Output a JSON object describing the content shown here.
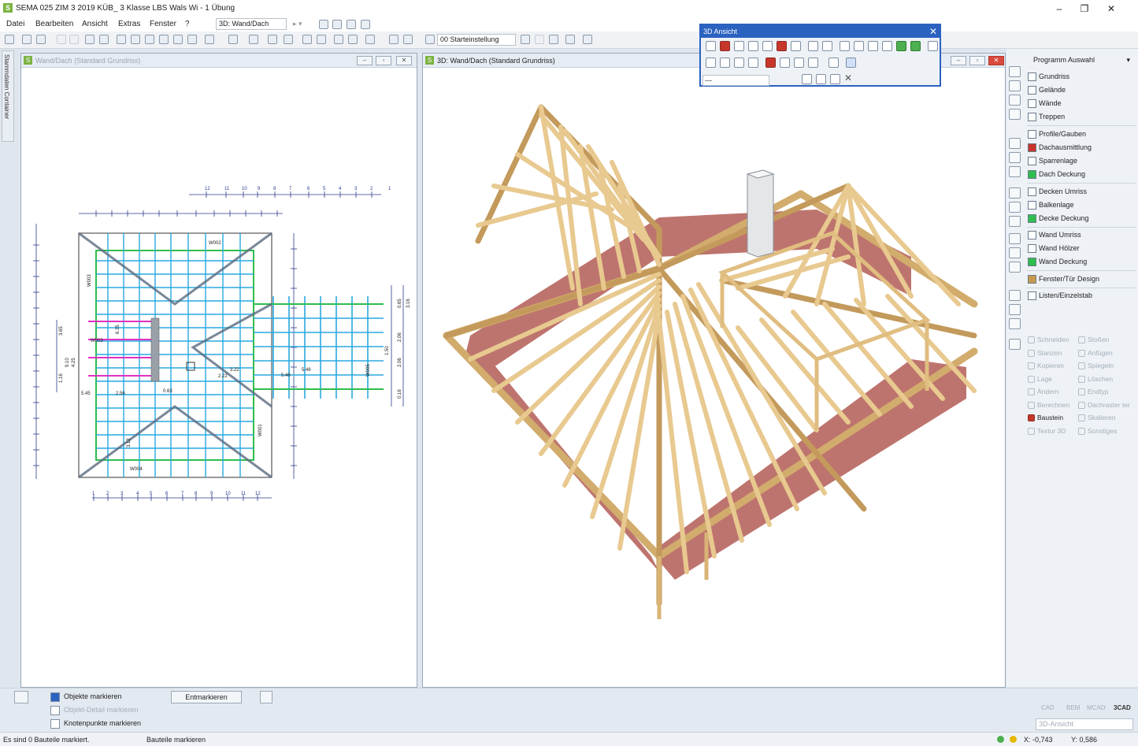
{
  "window": {
    "title": "SEMA 025 ZIM 3 2019 KÜB_ 3 Klasse LBS Wals Wi - 1 Übung",
    "app_logo": "S"
  },
  "menu": [
    "Datei",
    "Bearbeiten",
    "Ansicht",
    "Extras",
    "Fenster",
    "?"
  ],
  "toolbar": {
    "view_combo": "3D: Wand/Dach",
    "start_combo": "00 Starteinstellung"
  },
  "sidebar_tab": "Stammdaten Container",
  "left_pane": {
    "title": "Wand/Dach (Standard Grundriss)",
    "wall_labels": [
      "W002",
      "W003",
      "W001",
      "W004",
      "W005",
      "W005",
      "W006"
    ],
    "dims": [
      "5.46",
      "2.06",
      "1.50",
      "2.06",
      "0.65",
      "3.16",
      "0.16",
      "5.48",
      "3.22",
      "2.22",
      "5.45",
      "2.56",
      "6.35",
      "3.12",
      "0.63",
      "3.65",
      "9.10",
      "4.25",
      "1.16"
    ],
    "axis_top_numbers": [
      "12",
      "11",
      "10",
      "9",
      "8",
      "7",
      "6",
      "5",
      "4",
      "3",
      "2",
      "1"
    ],
    "axis_bottom_numbers": [
      "1",
      "2",
      "3",
      "4",
      "5",
      "6",
      "7",
      "8",
      "9",
      "10",
      "11",
      "12"
    ]
  },
  "right_pane": {
    "title": "3D: Wand/Dach (Standard Grundriss)"
  },
  "float_panel": {
    "title": "3D Ansicht",
    "input_value": "---"
  },
  "program": {
    "header": "Programm Auswahl",
    "groups": [
      [
        "Grundriss",
        "Gelände",
        "Wände",
        "Treppen"
      ],
      [
        "Profile/Gauben",
        "Dachausmittlung",
        "Sparrenlage",
        "Dach Deckung"
      ],
      [
        "Decken Umriss",
        "Balkenlage",
        "Decke Deckung"
      ],
      [
        "Wand Umriss",
        "Wand Hölzer",
        "Wand Deckung"
      ],
      [
        "Fenster/Tür Design"
      ],
      [
        "Listen/Einzelstab"
      ]
    ],
    "tools_left": [
      "Schneiden",
      "Stanzen",
      "Kopieren",
      "Lage",
      "Ändern",
      "Berechnen",
      "Baustein",
      "Textur 3D"
    ],
    "tools_right": [
      "Stoßen",
      "Anfügen",
      "Spiegeln",
      "Löschen",
      "Endtyp",
      "Dachraster ter",
      "Skalieren",
      "Sonstiges"
    ],
    "active_tool": "Baustein"
  },
  "bottom": {
    "options": [
      "Objekte markieren",
      "Objekt-Detail markieren",
      "Knotenpunkte markieren"
    ],
    "unmark_button": "Entmarkieren",
    "modes": [
      "CAD",
      "BEM",
      "MCAD",
      "3CAD"
    ],
    "view_combo": "3D-Ansicht"
  },
  "status": {
    "left": "Es sind 0 Bauteile markiert.",
    "mid": "Bauteile markieren",
    "x": "X: -0,743",
    "y": "Y: 0,586"
  },
  "colors": {
    "accent": "#2b62c0",
    "timber": "#e8c98f",
    "timber_dark": "#b8894e",
    "brick": "#b35c55",
    "plan_blue": "#29a9e0",
    "plan_green": "#2fbd4f",
    "plan_magenta": "#e030c0"
  }
}
